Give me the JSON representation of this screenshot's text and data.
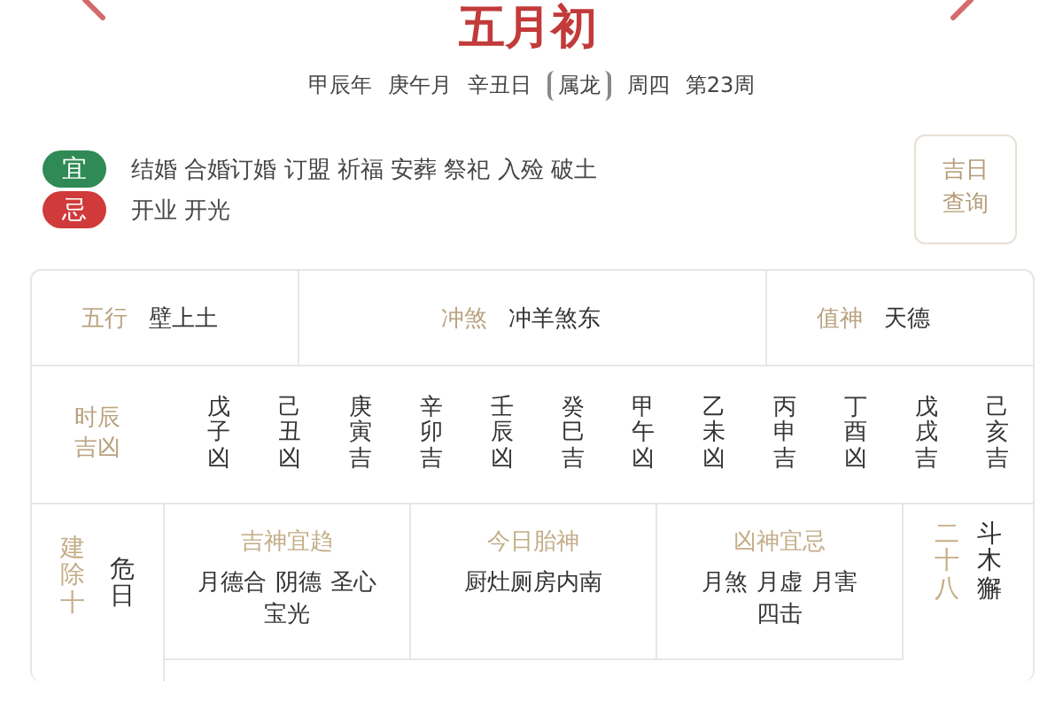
{
  "header": {
    "title": "五月初",
    "info": [
      "甲辰年",
      "庚午月",
      "辛丑日"
    ],
    "zodiac": "属龙",
    "weekday": "周四",
    "week": "第23周"
  },
  "yiji": [
    {
      "kind": "yi",
      "badge": "宜",
      "items": "结婚 合婚订婚 订盟 祈福 安葬 祭祀 入殓 破土"
    },
    {
      "kind": "ji",
      "badge": "忌",
      "items": "开业 开光"
    }
  ],
  "query_button": "吉日查询",
  "summary": [
    {
      "label": "五行",
      "value": "壁上土"
    },
    {
      "label": "冲煞",
      "value": "冲羊煞东"
    },
    {
      "label": "值神",
      "value": "天德"
    }
  ],
  "hours": {
    "label": "时辰吉凶",
    "items": [
      {
        "ganzhi": "戊子",
        "luck": "凶"
      },
      {
        "ganzhi": "己丑",
        "luck": "凶"
      },
      {
        "ganzhi": "庚寅",
        "luck": "吉"
      },
      {
        "ganzhi": "辛卯",
        "luck": "吉"
      },
      {
        "ganzhi": "壬辰",
        "luck": "凶"
      },
      {
        "ganzhi": "癸巳",
        "luck": "吉"
      },
      {
        "ganzhi": "甲午",
        "luck": "凶"
      },
      {
        "ganzhi": "乙未",
        "luck": "凶"
      },
      {
        "ganzhi": "丙申",
        "luck": "吉"
      },
      {
        "ganzhi": "丁酉",
        "luck": "凶"
      },
      {
        "ganzhi": "戊戌",
        "luck": "吉"
      },
      {
        "ganzhi": "己亥",
        "luck": "吉"
      }
    ]
  },
  "jianchu": {
    "label": "建除十",
    "value": "危日"
  },
  "gods": [
    {
      "label": "吉神宜趋",
      "terms": [
        "月德合",
        "阴德",
        "圣心",
        "宝光"
      ]
    },
    {
      "label": "今日胎神",
      "terms": [
        "厨灶厕房内南"
      ]
    },
    {
      "label": "凶神宜忌",
      "terms": [
        "月煞",
        "月虚",
        "月害",
        "四击"
      ]
    }
  ],
  "mansion": {
    "label": "二十八",
    "value": "斗木獬"
  }
}
